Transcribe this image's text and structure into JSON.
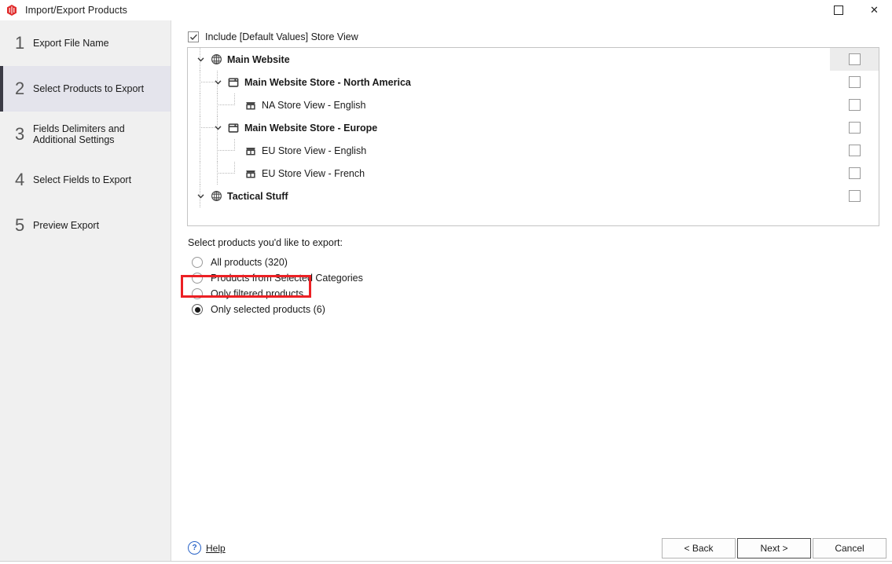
{
  "window": {
    "title": "Import/Export Products",
    "app_icon": "magento-icon",
    "maximize_label": "Maximize",
    "close_label": "✕"
  },
  "sidebar": {
    "steps": [
      {
        "num": "1",
        "label": "Export File Name",
        "active": false
      },
      {
        "num": "2",
        "label": "Select Products to Export",
        "active": true
      },
      {
        "num": "3",
        "label": "Fields Delimiters and Additional Settings",
        "active": false
      },
      {
        "num": "4",
        "label": "Select Fields to Export",
        "active": false
      },
      {
        "num": "5",
        "label": "Preview Export",
        "active": false
      }
    ]
  },
  "main": {
    "include_default": {
      "label": "Include [Default Values] Store View",
      "checked": true
    },
    "tree": [
      {
        "label": "Main Website",
        "icon": "globe-icon",
        "level": 0,
        "bold": true,
        "expandable": true,
        "checked": false,
        "row_highlight": true
      },
      {
        "label": "Main Website Store - North America",
        "icon": "store-icon",
        "level": 1,
        "bold": true,
        "expandable": true,
        "checked": false,
        "row_highlight": false
      },
      {
        "label": "NA Store View - English",
        "icon": "store-view-icon",
        "level": 2,
        "bold": false,
        "expandable": false,
        "checked": false,
        "row_highlight": false
      },
      {
        "label": "Main Website Store - Europe",
        "icon": "store-icon",
        "level": 1,
        "bold": true,
        "expandable": true,
        "checked": false,
        "row_highlight": false
      },
      {
        "label": "EU Store View - English",
        "icon": "store-view-icon",
        "level": 2,
        "bold": false,
        "expandable": false,
        "checked": false,
        "row_highlight": false
      },
      {
        "label": "EU Store View - French",
        "icon": "store-view-icon",
        "level": 2,
        "bold": false,
        "expandable": false,
        "checked": false,
        "row_highlight": false
      },
      {
        "label": "Tactical Stuff",
        "icon": "globe-icon",
        "level": 0,
        "bold": true,
        "expandable": true,
        "checked": false,
        "row_highlight": false
      }
    ],
    "products_caption": "Select products you'd like to export:",
    "product_options": [
      {
        "label": "All products (320)",
        "selected": false
      },
      {
        "label": "Products from Selected Categories",
        "selected": false
      },
      {
        "label": "Only filtered products",
        "selected": false
      },
      {
        "label": "Only selected products (6)",
        "selected": true
      }
    ],
    "highlight_color": "#ec2024"
  },
  "footer": {
    "help": "Help",
    "back": "< Back",
    "next": "Next >",
    "cancel": "Cancel"
  }
}
